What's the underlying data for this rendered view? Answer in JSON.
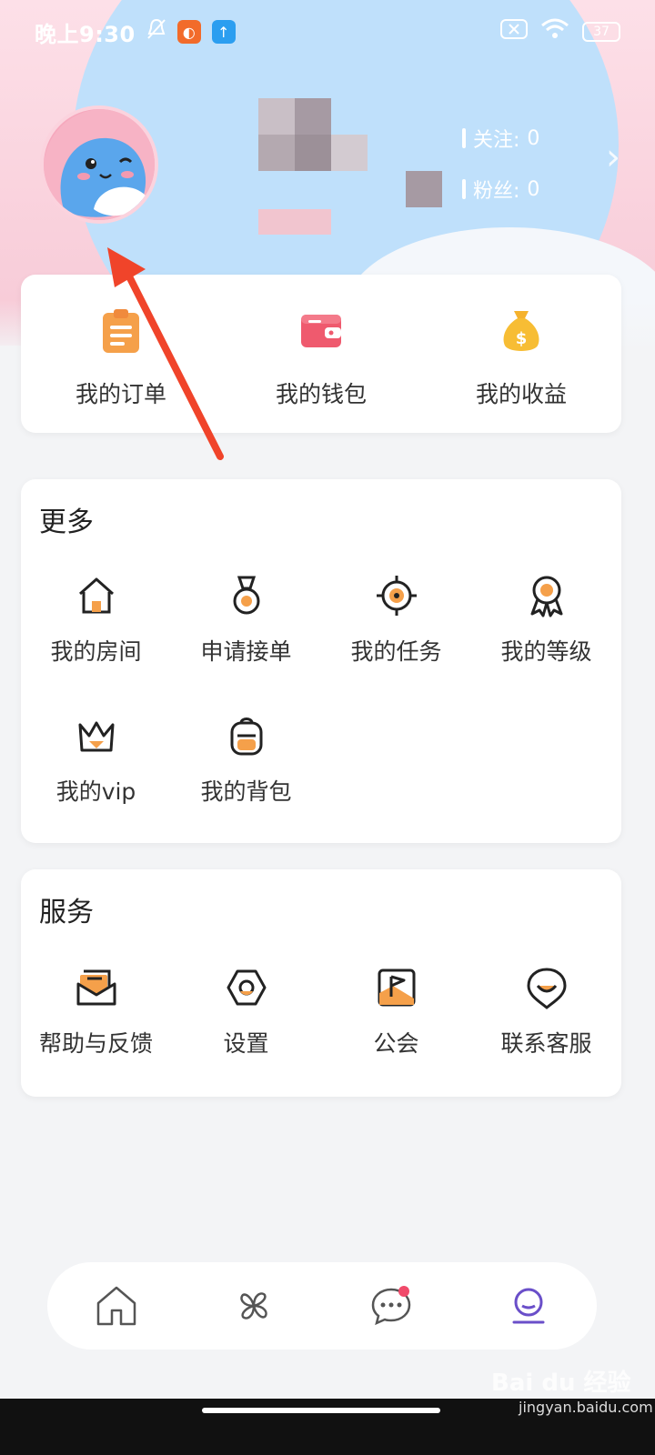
{
  "status_bar": {
    "time": "晚上9:30",
    "battery": "37"
  },
  "profile": {
    "following_label": "关注:",
    "following_count": "0",
    "followers_label": "粉丝:",
    "followers_count": "0"
  },
  "quick_actions": [
    {
      "label": "我的订单",
      "icon": "clipboard-icon"
    },
    {
      "label": "我的钱包",
      "icon": "wallet-icon"
    },
    {
      "label": "我的收益",
      "icon": "money-bag-icon"
    }
  ],
  "more": {
    "title": "更多",
    "items": [
      {
        "label": "我的房间",
        "icon": "house-icon"
      },
      {
        "label": "申请接单",
        "icon": "medal-icon"
      },
      {
        "label": "我的任务",
        "icon": "target-icon"
      },
      {
        "label": "我的等级",
        "icon": "badge-icon"
      },
      {
        "label": "我的vip",
        "icon": "crown-icon"
      },
      {
        "label": "我的背包",
        "icon": "backpack-icon"
      }
    ]
  },
  "service": {
    "title": "服务",
    "items": [
      {
        "label": "帮助与反馈",
        "icon": "mail-icon"
      },
      {
        "label": "设置",
        "icon": "settings-hex-icon"
      },
      {
        "label": "公会",
        "icon": "flag-icon"
      },
      {
        "label": "联系客服",
        "icon": "support-icon"
      }
    ]
  },
  "bottom_nav": [
    {
      "icon": "home-icon"
    },
    {
      "icon": "pinwheel-icon"
    },
    {
      "icon": "chat-icon"
    },
    {
      "icon": "profile-icon"
    }
  ],
  "watermark": {
    "text": "Bai du 经验",
    "sub": "jingyan.baidu.com"
  },
  "colors": {
    "accent_orange": "#f08a3c",
    "wallet_red": "#ef5a6e",
    "nav_active": "#6a4fc9"
  }
}
